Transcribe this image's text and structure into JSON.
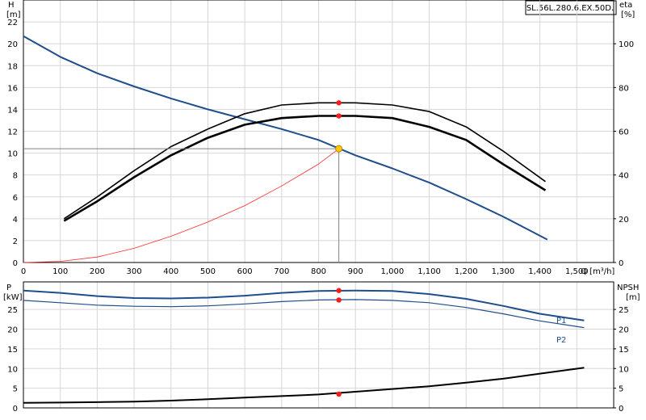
{
  "model_label": "SL.56L.280.6.EX.50D.",
  "colors": {
    "head_curve": "#1f4e8c",
    "efficiency_curves": "#000000",
    "system_curve": "#ff2a2a",
    "power_curves": "#1f4e8c",
    "npsh_curve": "#000000",
    "duty_point_marker": "#ffcc00",
    "op_point_marker": "#ff1a1a",
    "grid": "#d6d6d6"
  },
  "chart_data": [
    {
      "type": "line",
      "title": "",
      "x_axis": {
        "label": "Q [m³/h]",
        "range": [
          0,
          1600
        ],
        "ticks": [
          0,
          100,
          200,
          300,
          400,
          500,
          600,
          700,
          800,
          900,
          1000,
          1100,
          1200,
          1300,
          1400,
          1500
        ],
        "tick_labels": [
          "0",
          "100",
          "200",
          "300",
          "400",
          "500",
          "600",
          "700",
          "800",
          "900",
          "1,000",
          "1,100",
          "1,200",
          "1,300",
          "1,400",
          "1,500"
        ]
      },
      "y_axis_left": {
        "label_top": "H",
        "label_unit": "[m]",
        "range": [
          0,
          24
        ],
        "ticks": [
          0,
          2,
          4,
          6,
          8,
          10,
          12,
          14,
          16,
          18,
          20,
          22
        ]
      },
      "y_axis_right": {
        "label_top": "eta",
        "label_unit": "[%]",
        "range": [
          0,
          120
        ],
        "ticks": [
          0,
          20,
          40,
          60,
          80,
          100
        ]
      },
      "grid": true,
      "series": [
        {
          "key": "head",
          "axis": "left",
          "points": [
            [
              0,
              20.7
            ],
            [
              100,
              18.8
            ],
            [
              200,
              17.3
            ],
            [
              300,
              16.1
            ],
            [
              400,
              15.0
            ],
            [
              500,
              14.0
            ],
            [
              600,
              13.1
            ],
            [
              700,
              12.2
            ],
            [
              800,
              11.2
            ],
            [
              900,
              9.8
            ],
            [
              1000,
              8.6
            ],
            [
              1100,
              7.3
            ],
            [
              1200,
              5.8
            ],
            [
              1300,
              4.2
            ],
            [
              1420,
              2.1
            ]
          ]
        },
        {
          "key": "efficiency_upper",
          "axis": "right",
          "points": [
            [
              110,
              20
            ],
            [
              200,
              30
            ],
            [
              300,
              42
            ],
            [
              400,
              53
            ],
            [
              500,
              61
            ],
            [
              600,
              68
            ],
            [
              700,
              72
            ],
            [
              800,
              73
            ],
            [
              900,
              73
            ],
            [
              1000,
              72
            ],
            [
              1100,
              69
            ],
            [
              1200,
              62
            ],
            [
              1300,
              51
            ],
            [
              1415,
              37
            ]
          ]
        },
        {
          "key": "efficiency_lower",
          "axis": "right",
          "points": [
            [
              110,
              19
            ],
            [
              200,
              28
            ],
            [
              300,
              39
            ],
            [
              400,
              49
            ],
            [
              500,
              57
            ],
            [
              600,
              63
            ],
            [
              700,
              66
            ],
            [
              800,
              67
            ],
            [
              900,
              67
            ],
            [
              1000,
              66
            ],
            [
              1100,
              62
            ],
            [
              1200,
              56
            ],
            [
              1300,
              45
            ],
            [
              1415,
              33
            ]
          ]
        },
        {
          "key": "system_curve",
          "axis": "left",
          "points": [
            [
              0,
              0
            ],
            [
              100,
              0.1
            ],
            [
              200,
              0.5
            ],
            [
              300,
              1.3
            ],
            [
              400,
              2.4
            ],
            [
              500,
              3.7
            ],
            [
              600,
              5.2
            ],
            [
              700,
              7.0
            ],
            [
              800,
              9.0
            ],
            [
              855,
              10.4
            ]
          ]
        }
      ],
      "duty_point": {
        "q": 855,
        "h": 10.4
      },
      "op_markers": [
        {
          "axis": "right",
          "q": 855,
          "v": 73
        },
        {
          "axis": "right",
          "q": 855,
          "v": 67
        }
      ]
    },
    {
      "type": "line",
      "title": "",
      "x_axis": {
        "range": [
          0,
          1600
        ],
        "ticks": [
          0,
          100,
          200,
          300,
          400,
          500,
          600,
          700,
          800,
          900,
          1000,
          1100,
          1200,
          1300,
          1400,
          1500
        ]
      },
      "y_axis_left": {
        "label_top": "P",
        "label_unit": "[kW]",
        "range": [
          0,
          32
        ],
        "ticks": [
          0,
          5,
          10,
          15,
          20,
          25
        ]
      },
      "y_axis_right": {
        "label_top": "NPSH",
        "label_unit": "[m]",
        "range": [
          0,
          32
        ],
        "ticks": [
          0,
          5,
          10,
          15,
          20,
          25
        ]
      },
      "grid": true,
      "series": [
        {
          "key": "P1",
          "name": "P1",
          "axis": "left",
          "points": [
            [
              0,
              29.8
            ],
            [
              100,
              29.2
            ],
            [
              200,
              28.4
            ],
            [
              300,
              27.9
            ],
            [
              400,
              27.8
            ],
            [
              500,
              28.0
            ],
            [
              600,
              28.5
            ],
            [
              700,
              29.2
            ],
            [
              800,
              29.7
            ],
            [
              900,
              29.8
            ],
            [
              1000,
              29.7
            ],
            [
              1100,
              28.9
            ],
            [
              1200,
              27.7
            ],
            [
              1300,
              25.9
            ],
            [
              1400,
              23.9
            ],
            [
              1520,
              22.2
            ]
          ]
        },
        {
          "key": "P2",
          "name": "P2",
          "axis": "left",
          "points": [
            [
              0,
              27.3
            ],
            [
              100,
              26.7
            ],
            [
              200,
              26.1
            ],
            [
              300,
              25.8
            ],
            [
              400,
              25.7
            ],
            [
              500,
              25.9
            ],
            [
              600,
              26.4
            ],
            [
              700,
              27.0
            ],
            [
              800,
              27.4
            ],
            [
              900,
              27.5
            ],
            [
              1000,
              27.3
            ],
            [
              1100,
              26.7
            ],
            [
              1200,
              25.5
            ],
            [
              1300,
              23.9
            ],
            [
              1400,
              22.1
            ],
            [
              1520,
              20.4
            ]
          ]
        },
        {
          "key": "NPSH",
          "axis": "right",
          "points": [
            [
              0,
              1.3
            ],
            [
              100,
              1.35
            ],
            [
              200,
              1.45
            ],
            [
              300,
              1.6
            ],
            [
              400,
              1.85
            ],
            [
              500,
              2.2
            ],
            [
              600,
              2.6
            ],
            [
              700,
              3.0
            ],
            [
              800,
              3.4
            ],
            [
              900,
              4.1
            ],
            [
              1000,
              4.8
            ],
            [
              1100,
              5.5
            ],
            [
              1200,
              6.4
            ],
            [
              1300,
              7.4
            ],
            [
              1400,
              8.7
            ],
            [
              1520,
              10.2
            ]
          ]
        }
      ],
      "op_markers": [
        {
          "axis": "left",
          "q": 855,
          "v": 29.8
        },
        {
          "axis": "left",
          "q": 855,
          "v": 27.4
        },
        {
          "axis": "right",
          "q": 855,
          "v": 3.5
        }
      ]
    }
  ]
}
